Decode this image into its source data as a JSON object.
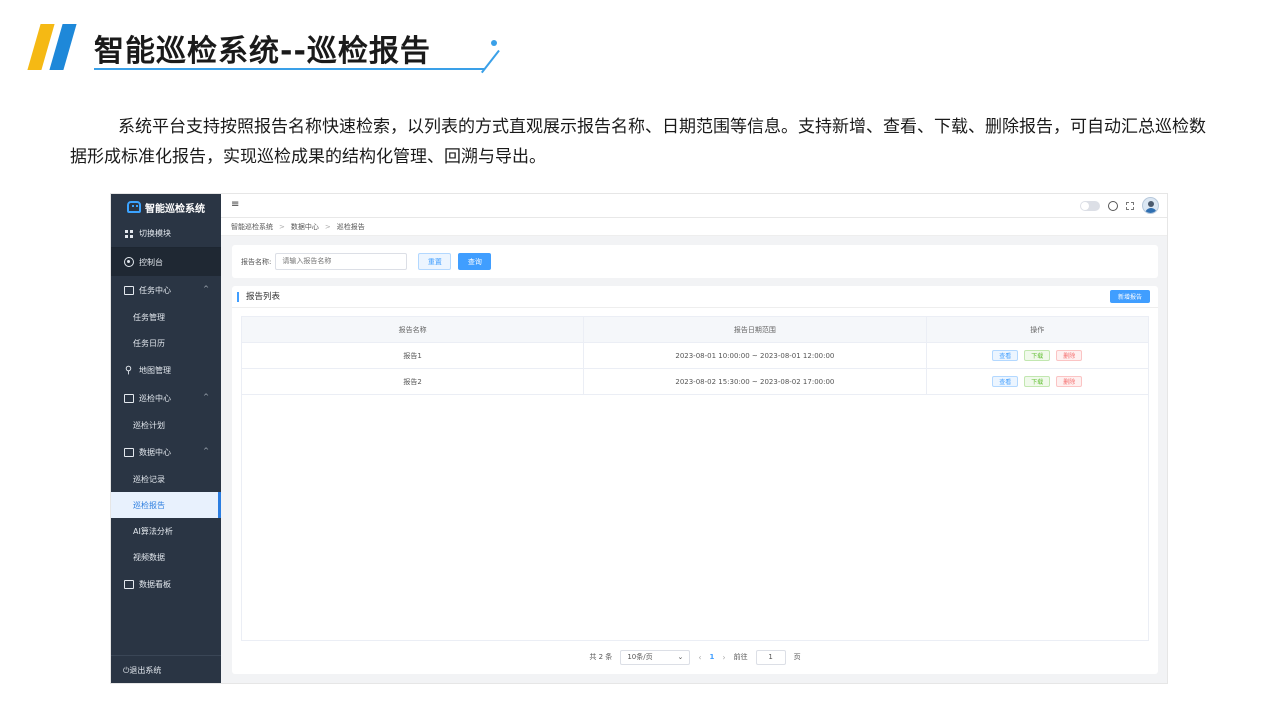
{
  "slide": {
    "title": "智能巡检系统--巡检报告",
    "description": "系统平台支持按照报告名称快速检索，以列表的方式直观展示报告名称、日期范围等信息。支持新增、查看、下载、删除报告，可自动汇总巡检数据形成标准化报告，实现巡检成果的结构化管理、回溯与导出。",
    "accent_colors": {
      "yellow": "#f5b914",
      "blue": "#1e88d9"
    }
  },
  "app": {
    "name": "智能巡检系统",
    "sidebar": {
      "switch_module": "切换模块",
      "console": "控制台",
      "task_center": "任务中心",
      "task_manage": "任务管理",
      "task_calendar": "任务日历",
      "map_manage": "地图管理",
      "inspect_center": "巡检中心",
      "inspect_plan": "巡检计划",
      "data_center": "数据中心",
      "inspect_record": "巡检记录",
      "inspect_report": "巡检报告",
      "ai_analysis": "AI算法分析",
      "video_data": "视频数据",
      "dashboard": "数据看板",
      "logout": "退出系统"
    },
    "topbar": {
      "menu_icon": "≡"
    },
    "breadcrumb": [
      "智能巡检系统",
      "数据中心",
      "巡检报告"
    ],
    "search": {
      "label": "报告名称:",
      "placeholder": "请输入报告名称",
      "reset": "重置",
      "query": "查询"
    },
    "list": {
      "title": "报告列表",
      "add_button": "新增报告",
      "columns": [
        "报告名称",
        "报告日期范围",
        "操作"
      ],
      "rows": [
        {
          "name": "报告1",
          "range": "2023-08-01 10:00:00 ~ 2023-08-01 12:00:00"
        },
        {
          "name": "报告2",
          "range": "2023-08-02 15:30:00 ~ 2023-08-02 17:00:00"
        }
      ],
      "actions": {
        "view": "查看",
        "download": "下载",
        "delete": "删除"
      }
    },
    "pager": {
      "total": "共 2 条",
      "page_size": "10条/页",
      "current_page": "1",
      "goto_label": "前往",
      "goto_value": "1",
      "page_suffix": "页"
    }
  }
}
